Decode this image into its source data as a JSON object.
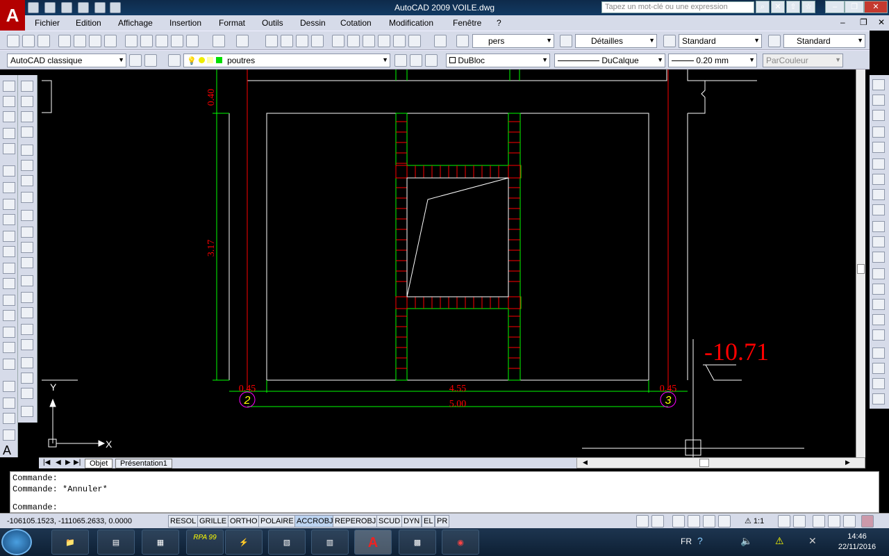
{
  "window": {
    "title": "AutoCAD 2009  VOILE.dwg",
    "search_placeholder": "Tapez un mot-clé ou une expression"
  },
  "menu": [
    "Fichier",
    "Edition",
    "Affichage",
    "Insertion",
    "Format",
    "Outils",
    "Dessin",
    "Cotation",
    "Modification",
    "Fenêtre",
    "?"
  ],
  "toolbar1": {
    "view_combo": "pers",
    "dim_style": "Détailles",
    "text_style": "Standard",
    "table_style": "Standard"
  },
  "toolbar2": {
    "workspace": "AutoCAD classique",
    "layer": "poutres",
    "color": "DuBloc",
    "linetype": "DuCalque",
    "lineweight": "0.20 mm",
    "plotstyle": "ParCouleur"
  },
  "drawing": {
    "dim_vertical_top": "0.40",
    "dim_vertical_main": "3.17",
    "dim_left": "0.45",
    "dim_mid": "4.55",
    "dim_right": "0.45",
    "dim_total": "5.00",
    "axis_2": "2",
    "axis_3": "3",
    "elevation": "-10.71",
    "ucs_x": "X",
    "ucs_y": "Y",
    "colors": {
      "red": "#ff0000",
      "green": "#00ff00",
      "white": "#ffffff",
      "magenta": "#ff00ff",
      "yellow": "#ffff00"
    }
  },
  "tabs": [
    "Objet",
    "Présentation1"
  ],
  "command": [
    "Commande:",
    "Commande: *Annuler*",
    "Commande:"
  ],
  "status": {
    "coords": "-106105.1523, -111065.2633, 0.0000",
    "buttons": [
      "RESOL",
      "GRILLE",
      "ORTHO",
      "POLAIRE",
      "ACCROBJ",
      "REPEROBJ",
      "SCUD",
      "DYN",
      "EL",
      "PR"
    ],
    "scale": "1:1"
  },
  "taskbar": {
    "apps": [
      "explorer",
      "robot",
      "calc-grid",
      "RPA 99",
      "flash",
      "calculator",
      "calculator2",
      "AutoCAD",
      "chart",
      "Chrome"
    ],
    "lang": "FR",
    "time": "14:46",
    "date": "22/11/2016"
  }
}
